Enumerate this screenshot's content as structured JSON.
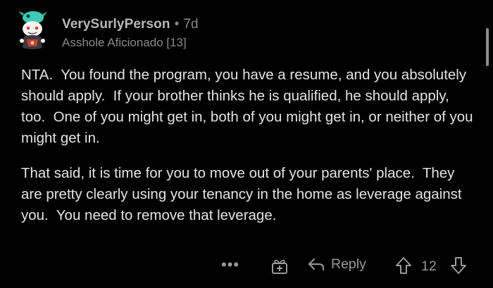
{
  "comment": {
    "username": "VerySurlyPerson",
    "separator": "•",
    "age": "7d",
    "flair": "Asshole Aficionado [13]",
    "paragraphs": [
      "NTA.  You found the program, you have a resume, and you absolutely should apply.  If your brother thinks he is qualified, he should apply, too.  One of you might get in, both of you might get in, or neither of you might get in.",
      "That said, it is time for you to move out of your parents' place.  They are pretty clearly using your tenancy in the home as leverage against you.  You need to remove that leverage."
    ]
  },
  "actions": {
    "more_label": "•••",
    "reply_label": "Reply",
    "score": "12"
  },
  "icons": {
    "avatar": "snoo-avatar-icon",
    "award": "award-gift-icon",
    "reply": "reply-arrow-icon",
    "upvote": "upvote-arrow-icon",
    "downvote": "downvote-arrow-icon"
  },
  "colors": {
    "background": "#000000",
    "username": "#b8b8b8",
    "meta": "#8a8a8a",
    "body": "#e4e4e4",
    "action": "#9a9a9a"
  }
}
